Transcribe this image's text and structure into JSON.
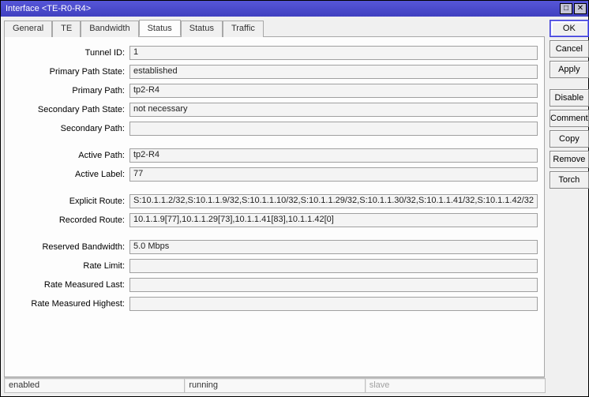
{
  "window": {
    "title": "Interface <TE-R0-R4>"
  },
  "tabs": [
    "General",
    "TE",
    "Bandwidth",
    "Status",
    "Status",
    "Traffic"
  ],
  "active_tab_index": 3,
  "fields": {
    "tunnel_id": {
      "label": "Tunnel ID:",
      "value": "1"
    },
    "primary_state": {
      "label": "Primary Path State:",
      "value": "established"
    },
    "primary_path": {
      "label": "Primary Path:",
      "value": "tp2-R4"
    },
    "secondary_state": {
      "label": "Secondary Path State:",
      "value": "not necessary"
    },
    "secondary_path": {
      "label": "Secondary Path:",
      "value": ""
    },
    "active_path": {
      "label": "Active Path:",
      "value": "tp2-R4"
    },
    "active_label": {
      "label": "Active Label:",
      "value": "77"
    },
    "explicit_route": {
      "label": "Explicit Route:",
      "value": "S:10.1.1.2/32,S:10.1.1.9/32,S:10.1.1.10/32,S:10.1.1.29/32,S:10.1.1.30/32,S:10.1.1.41/32,S:10.1.1.42/32"
    },
    "recorded_route": {
      "label": "Recorded Route:",
      "value": "10.1.1.9[77],10.1.1.29[73],10.1.1.41[83],10.1.1.42[0]"
    },
    "reserved_bw": {
      "label": "Reserved Bandwidth:",
      "value": "5.0 Mbps"
    },
    "rate_limit": {
      "label": "Rate Limit:",
      "value": ""
    },
    "rate_meas_last": {
      "label": "Rate Measured Last:",
      "value": ""
    },
    "rate_meas_high": {
      "label": "Rate Measured Highest:",
      "value": ""
    }
  },
  "buttons": {
    "ok": "OK",
    "cancel": "Cancel",
    "apply": "Apply",
    "disable": "Disable",
    "comment": "Comment",
    "copy": "Copy",
    "remove": "Remove",
    "torch": "Torch"
  },
  "status": {
    "a": "enabled",
    "b": "running",
    "c": "slave"
  }
}
